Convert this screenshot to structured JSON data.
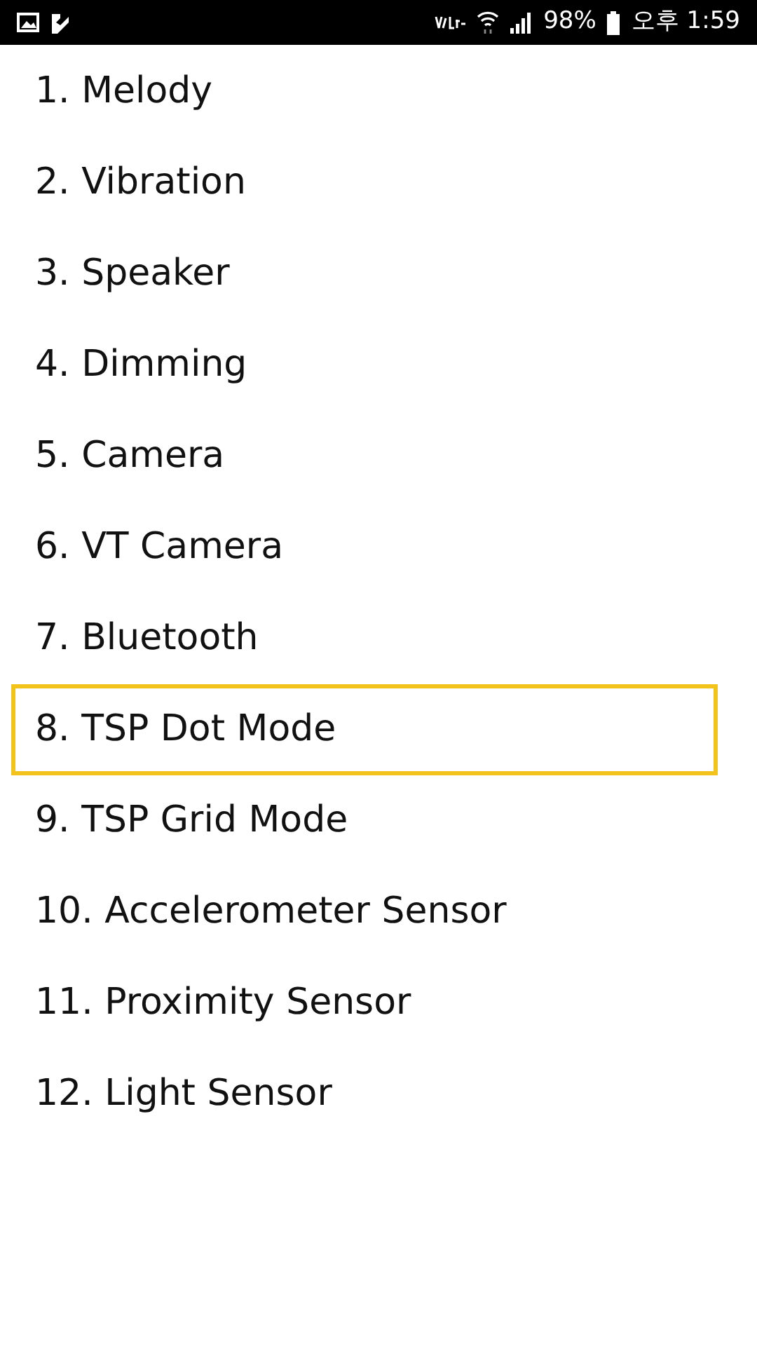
{
  "status_bar": {
    "battery": "98%",
    "time": "오후 1:59"
  },
  "items": [
    {
      "label": "1. Melody",
      "selected": false
    },
    {
      "label": "2. Vibration",
      "selected": false
    },
    {
      "label": "3. Speaker",
      "selected": false
    },
    {
      "label": "4. Dimming",
      "selected": false
    },
    {
      "label": "5. Camera",
      "selected": false
    },
    {
      "label": "6. VT Camera",
      "selected": false
    },
    {
      "label": "7. Bluetooth",
      "selected": false
    },
    {
      "label": "8. TSP Dot Mode",
      "selected": true
    },
    {
      "label": "9. TSP Grid Mode",
      "selected": false
    },
    {
      "label": "10. Accelerometer Sensor",
      "selected": false
    },
    {
      "label": "11. Proximity Sensor",
      "selected": false
    },
    {
      "label": "12. Light Sensor",
      "selected": false
    }
  ]
}
